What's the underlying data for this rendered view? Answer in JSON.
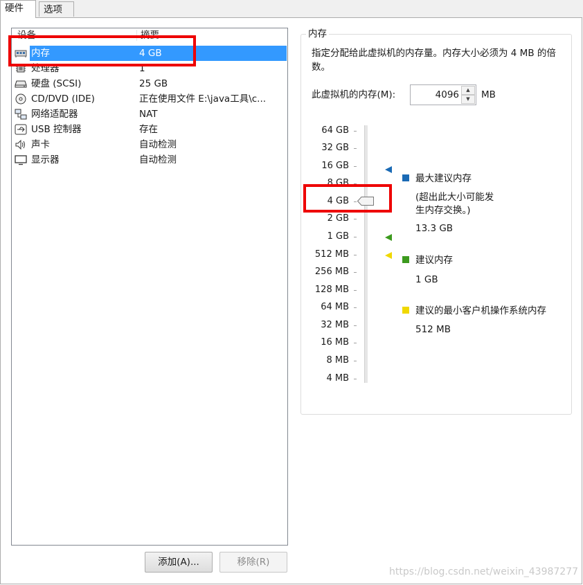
{
  "tabs": {
    "hardware": "硬件",
    "options": "选项"
  },
  "device_list": {
    "col_device": "设备",
    "col_summary": "摘要",
    "rows": [
      {
        "icon": "memory-icon",
        "name": "内存",
        "value": "4 GB"
      },
      {
        "icon": "processor-icon",
        "name": "处理器",
        "value": "1"
      },
      {
        "icon": "hard-disk-icon",
        "name": "硬盘 (SCSI)",
        "value": "25 GB"
      },
      {
        "icon": "cd-dvd-icon",
        "name": "CD/DVD (IDE)",
        "value": "正在使用文件 E:\\java工具\\c..."
      },
      {
        "icon": "network-adapter-icon",
        "name": "网络适配器",
        "value": "NAT"
      },
      {
        "icon": "usb-icon",
        "name": "USB 控制器",
        "value": "存在"
      },
      {
        "icon": "sound-card-icon",
        "name": "声卡",
        "value": "自动检测"
      },
      {
        "icon": "display-icon",
        "name": "显示器",
        "value": "自动检测"
      }
    ]
  },
  "buttons": {
    "add": "添加(A)...",
    "remove": "移除(R)"
  },
  "memory": {
    "title": "内存",
    "description": "指定分配给此虚拟机的内存量。内存大小必须为 4 MB 的倍数。",
    "field_label": "此虚拟机的内存(M):",
    "value": "4096",
    "unit": "MB",
    "scale": [
      "64 GB",
      "32 GB",
      "16 GB",
      "8 GB",
      "4 GB",
      "2 GB",
      "1 GB",
      "512 MB",
      "256 MB",
      "128 MB",
      "64 MB",
      "32 MB",
      "16 MB",
      "8 MB",
      "4 MB"
    ],
    "current_scale_value": "4 GB",
    "legend": {
      "max": {
        "title": "最大建议内存",
        "note": "(超出此大小可能发生内存交换。)",
        "value": "13.3 GB",
        "color": "#1a6ab5"
      },
      "recommended": {
        "title": "建议内存",
        "value": "1 GB",
        "color": "#3c9a1e"
      },
      "min_os": {
        "title": "建议的最小客户机操作系统内存",
        "value": "512 MB",
        "color": "#f0d800"
      }
    }
  },
  "watermark": "https://blog.csdn.net/weixin_43987277"
}
